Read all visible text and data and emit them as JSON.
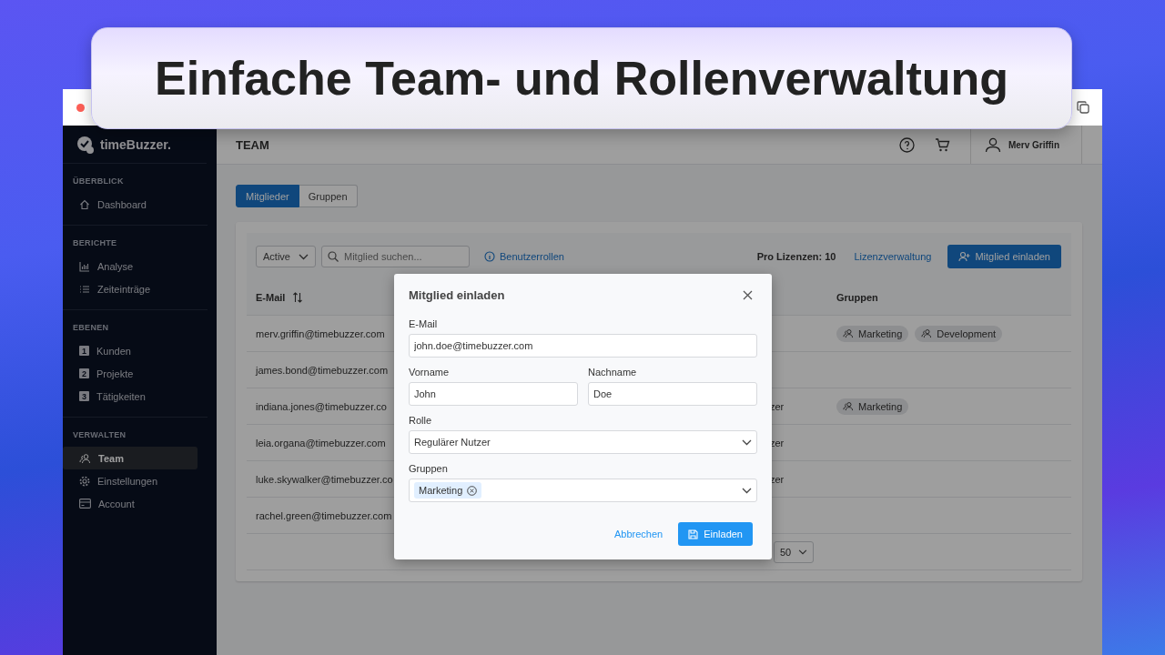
{
  "banner": {
    "title": "Einfache Team- und Rollenverwaltung"
  },
  "sidebar": {
    "logo": "timeBuzzer.",
    "sections": [
      {
        "title": "ÜBERBLICK",
        "items": [
          {
            "label": "Dashboard",
            "kind": "home",
            "selected": false
          }
        ]
      },
      {
        "title": "BERICHTE",
        "items": [
          {
            "label": "Analyse",
            "kind": "chart",
            "selected": false
          },
          {
            "label": "Zeiteinträge",
            "kind": "list",
            "selected": false
          }
        ]
      },
      {
        "title": "EBENEN",
        "items": [
          {
            "label": "Kunden",
            "kind": "number",
            "badge": "1",
            "selected": false
          },
          {
            "label": "Projekte",
            "kind": "number",
            "badge": "2",
            "selected": false
          },
          {
            "label": "Tätigkeiten",
            "kind": "number",
            "badge": "3",
            "selected": false
          }
        ]
      },
      {
        "title": "VERWALTEN",
        "items": [
          {
            "label": "Team",
            "kind": "users",
            "selected": true
          },
          {
            "label": "Einstellungen",
            "kind": "gear",
            "selected": false
          },
          {
            "label": "Account",
            "kind": "card",
            "selected": false
          }
        ]
      }
    ]
  },
  "header": {
    "title": "TEAM",
    "user": "Merv Griffin"
  },
  "tabs": [
    {
      "label": "Mitglieder",
      "selected": true
    },
    {
      "label": "Gruppen",
      "selected": false
    }
  ],
  "toolbar": {
    "status_filter": "Active",
    "search_placeholder": "Mitglied suchen...",
    "roles_link": "Benutzerrollen",
    "licenses": "Pro Lizenzen: 10",
    "license_link": "Lizenzverwaltung",
    "invite_button": "Mitglied einladen"
  },
  "table": {
    "columns": [
      "E-Mail",
      "Gruppen"
    ],
    "rows": [
      {
        "email": "merv.griffin@timebuzzer.com",
        "groups": [
          "Marketing",
          "Development"
        ]
      },
      {
        "email": "james.bond@timebuzzer.com",
        "groups": []
      },
      {
        "email": "indiana.jones@timebuzzer.co",
        "column_2": "zer",
        "groups": [
          "Marketing"
        ]
      },
      {
        "email": "leia.organa@timebuzzer.com",
        "column_2": "zer",
        "groups": []
      },
      {
        "email": "luke.skywalker@timebuzzer.co",
        "column_2": "zer",
        "groups": []
      },
      {
        "email": "rachel.green@timebuzzer.com",
        "groups": []
      }
    ]
  },
  "pagination": {
    "page_size": "50"
  },
  "dialog": {
    "title": "Mitglied einladen",
    "email_label": "E-Mail",
    "email": "john.doe@timebuzzer.com",
    "first_name_label": "Vorname",
    "first_name": "John",
    "last_name_label": "Nachname",
    "last_name": "Doe",
    "role_label": "Rolle",
    "role": "Regulärer Nutzer",
    "groups_label": "Gruppen",
    "groups": [
      "Marketing"
    ],
    "cancel": "Abbrechen",
    "submit": "Einladen"
  }
}
